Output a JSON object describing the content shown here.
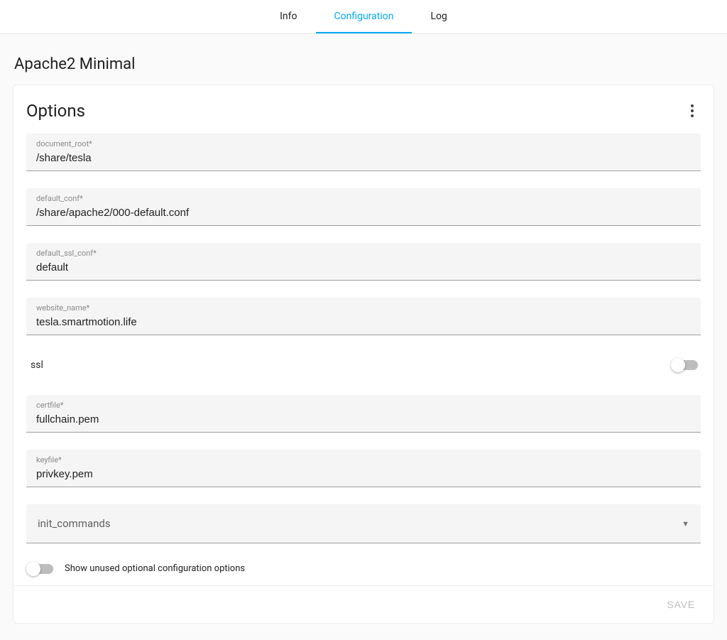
{
  "tabs": {
    "info": "Info",
    "configuration": "Configuration",
    "log": "Log",
    "active": "configuration"
  },
  "page": {
    "title": "Apache2 Minimal"
  },
  "card": {
    "title": "Options"
  },
  "fields": {
    "document_root": {
      "label": "document_root*",
      "value": "/share/tesla"
    },
    "default_conf": {
      "label": "default_conf*",
      "value": "/share/apache2/000-default.conf"
    },
    "default_ssl_conf": {
      "label": "default_ssl_conf*",
      "value": "default"
    },
    "website_name": {
      "label": "website_name*",
      "value": "tesla.smartmotion.life"
    },
    "ssl": {
      "label": "ssl",
      "on": false
    },
    "certfile": {
      "label": "certfile*",
      "value": "fullchain.pem"
    },
    "keyfile": {
      "label": "keyfile*",
      "value": "privkey.pem"
    },
    "init_commands": {
      "label": "init_commands"
    }
  },
  "footer": {
    "show_unused_label": "Show unused optional configuration options",
    "show_unused_on": false
  },
  "actions": {
    "save": "SAVE"
  }
}
